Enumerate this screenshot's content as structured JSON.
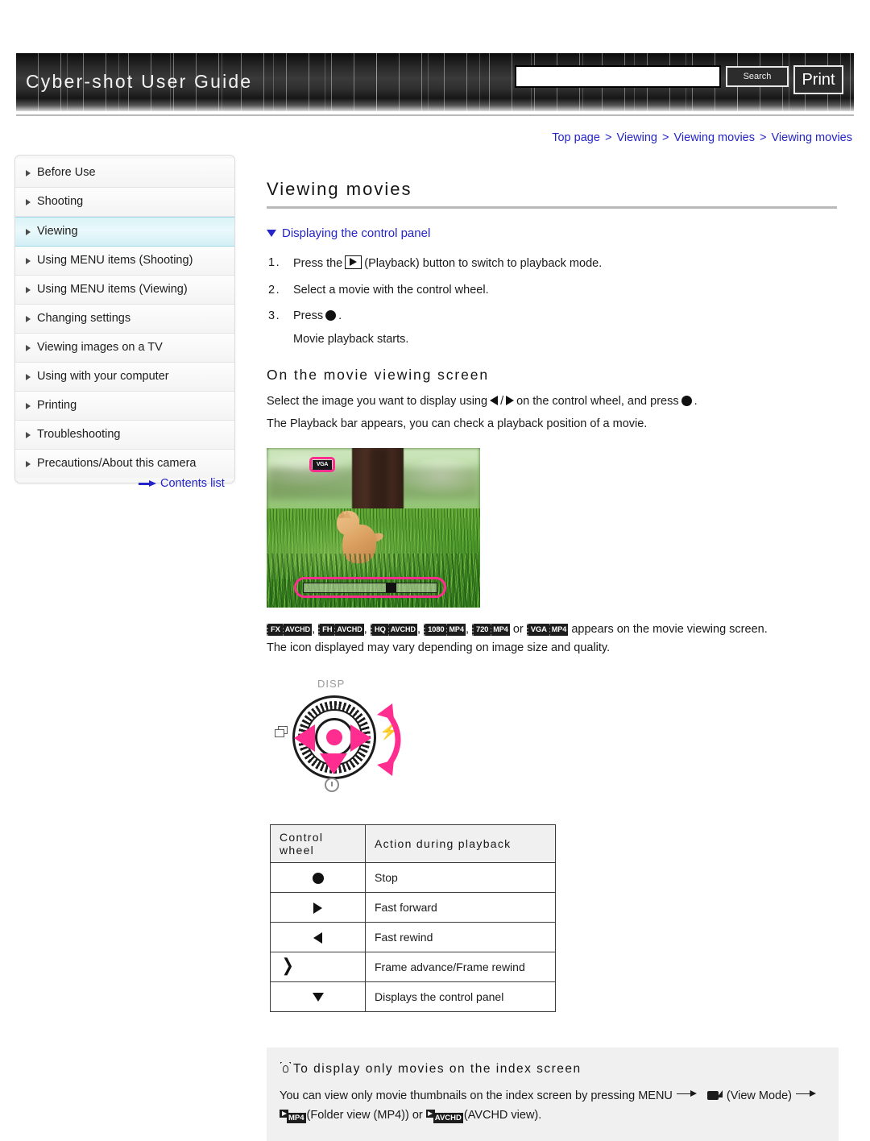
{
  "header": {
    "site_title": "Cyber-shot User Guide",
    "search_value": "",
    "search_placeholder": "",
    "search_button": "Search",
    "print_button": "Print"
  },
  "breadcrumb": {
    "items": [
      "Top page",
      "Viewing",
      "Viewing movies",
      "Viewing movies"
    ],
    "separator": ">",
    "color": "#2424c8"
  },
  "sidebar": {
    "items": [
      {
        "label": "Before Use",
        "active": false
      },
      {
        "label": "Shooting",
        "active": false
      },
      {
        "label": "Viewing",
        "active": true
      },
      {
        "label": "Using MENU items (Shooting)",
        "active": false
      },
      {
        "label": "Using MENU items (Viewing)",
        "active": false
      },
      {
        "label": "Changing settings",
        "active": false
      },
      {
        "label": "Viewing images on a TV",
        "active": false
      },
      {
        "label": "Using with your computer",
        "active": false
      },
      {
        "label": "Printing",
        "active": false
      },
      {
        "label": "Troubleshooting",
        "active": false
      },
      {
        "label": "Precautions/About this camera",
        "active": false
      }
    ],
    "contents_link": "Contents list",
    "active_color": "#d9f3f7"
  },
  "main": {
    "page_title": "Viewing movies",
    "section_link": "Displaying the control panel",
    "steps": [
      {
        "num": "1.",
        "pre": "Press the",
        "post": "(Playback) button to switch to playback mode.",
        "icon": "playback-icon"
      },
      {
        "num": "2.",
        "pre": "Select a movie with the control wheel.",
        "post": "",
        "icon": ""
      },
      {
        "num": "3.",
        "pre": "Press",
        "post": ".",
        "icon": "center-button-icon",
        "sub": "Movie playback starts."
      }
    ],
    "subhead": "On the movie viewing screen",
    "line_select_a": "Select the image you want to display using",
    "line_select_sep": "/",
    "line_select_b": "on the control wheel, and press",
    "line_select_c": ".",
    "line_playbar": "The Playback bar appears, you can check a playback position of a movie.",
    "camera_screen": {
      "badge": "VGA",
      "playbar_position_pct": 62
    },
    "formats": [
      {
        "chip": "FX",
        "label": "AVCHD"
      },
      {
        "chip": "FH",
        "label": "AVCHD"
      },
      {
        "chip": "HQ",
        "label": "AVCHD"
      },
      {
        "chip": "1080",
        "label": "MP4"
      },
      {
        "chip": "720",
        "label": "MP4"
      },
      {
        "chip": "VGA",
        "label": "MP4"
      }
    ],
    "formats_or": "or",
    "formats_tail": "appears on the movie viewing screen.",
    "formats_note": "The icon displayed may vary depending on image size and quality.",
    "wheel": {
      "disp_label": "DISP",
      "left_icon": "burst-icon",
      "right_icon": "flash-icon",
      "bottom_icon": "self-timer-icon",
      "accent_color": "#ff2d8f"
    },
    "table": {
      "headers": [
        "Control wheel",
        "Action during playback"
      ],
      "rows": [
        {
          "symbol": "center-button-icon",
          "action": "Stop"
        },
        {
          "symbol": "right-arrow-icon",
          "action": "Fast forward"
        },
        {
          "symbol": "left-arrow-icon",
          "action": "Fast rewind"
        },
        {
          "symbol": "rotate-wheel-icon",
          "action": "Frame advance/Frame rewind"
        },
        {
          "symbol": "down-arrow-icon",
          "action": "Displays the control panel"
        }
      ]
    },
    "tip": {
      "title": "To display only movies on the index screen",
      "line1_a": "You can view only movie thumbnails on the index screen by pressing MENU",
      "line1_b": "(View Mode)",
      "line2_chip1": "MP4",
      "line2_a": "(Folder view (MP4)) or",
      "line2_chip2": "AVCHD",
      "line2_b": "(AVCHD view)."
    }
  }
}
